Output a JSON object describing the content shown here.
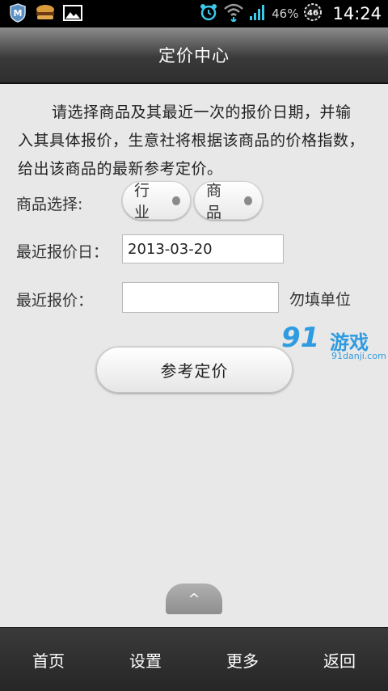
{
  "status_bar": {
    "icons_left": [
      "shield-m-icon",
      "burger-icon",
      "image-icon"
    ],
    "icons_right": [
      "alarm-clock-icon",
      "wifi-icon",
      "signal-icon",
      "battery-icon"
    ],
    "battery_percent": "46%",
    "battery_badge": "46",
    "time": "14:24"
  },
  "header": {
    "title": "定价中心"
  },
  "intro": {
    "text": "请选择商品及其最近一次的报价日期，并输入其具体报价，生意社将根据该商品的价格指数，给出该商品的最新参考定价。"
  },
  "form": {
    "product_label": "商品选择:",
    "industry_option": "行业",
    "product_option": "商品",
    "date_label": "最近报价日：",
    "date_value": "2013-03-20",
    "price_label": "最近报价：",
    "price_value": "",
    "unit_hint": "勿填单位",
    "submit_label": "参考定价"
  },
  "watermark": {
    "logo": "91",
    "name": "游戏",
    "url": "91danji.com"
  },
  "expand_tab": {
    "label": "^"
  },
  "bottom_nav": {
    "items": [
      {
        "label": "首页"
      },
      {
        "label": "设置"
      },
      {
        "label": "更多"
      },
      {
        "label": "返回"
      }
    ]
  }
}
